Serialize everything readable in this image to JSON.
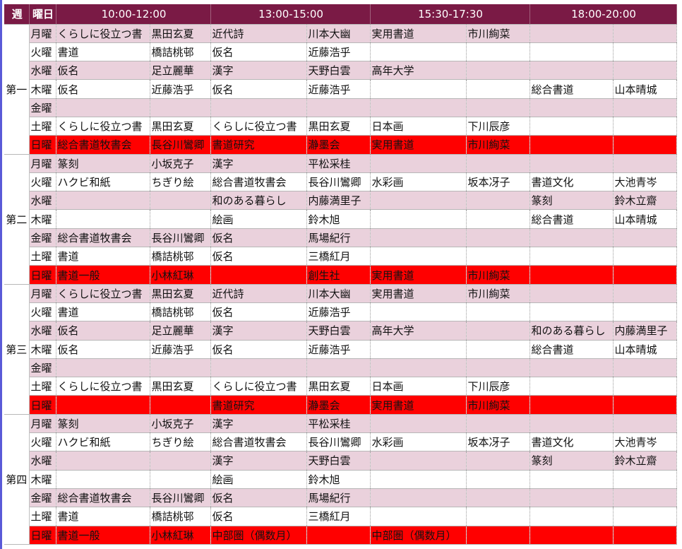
{
  "header": {
    "week": "週",
    "day": "曜日",
    "slots": [
      "10:00-12:00",
      "13:00-15:00",
      "15:30-17:30",
      "18:00-20:00"
    ]
  },
  "weeks": [
    {
      "label": "第一",
      "rows": [
        {
          "style": "pink",
          "day": "月曜",
          "cells": [
            "くらしに役立つ書",
            "黒田玄夏",
            "近代詩",
            "川本大幽",
            "実用書道",
            "市川絢菜",
            "",
            ""
          ]
        },
        {
          "style": "white",
          "day": "火曜",
          "cells": [
            "書道",
            "橋詰桃邨",
            "仮名",
            "近藤浩乎",
            "",
            "",
            "",
            ""
          ]
        },
        {
          "style": "pink",
          "day": "水曜",
          "cells": [
            "仮名",
            "足立麗華",
            "漢字",
            "天野白雲",
            "高年大学",
            "",
            "",
            ""
          ]
        },
        {
          "style": "white",
          "day": "木曜",
          "cells": [
            "仮名",
            "近藤浩乎",
            "仮名",
            "近藤浩乎",
            "",
            "",
            "総合書道",
            "山本晴城"
          ]
        },
        {
          "style": "pink",
          "day": "金曜",
          "cells": [
            "",
            "",
            "",
            "",
            "",
            "",
            "",
            ""
          ]
        },
        {
          "style": "white",
          "day": "土曜",
          "cells": [
            "くらしに役立つ書",
            "黒田玄夏",
            "くらしに役立つ書",
            "黒田玄夏",
            "日本画",
            "下川辰彦",
            "",
            ""
          ]
        },
        {
          "style": "red",
          "day": "日曜",
          "cells": [
            "総合書道牧書会",
            "長谷川鸞卿",
            "書道研究",
            "瀞墨会",
            "実用書道",
            "市川絢菜",
            "",
            ""
          ]
        }
      ]
    },
    {
      "label": "第二",
      "rows": [
        {
          "style": "pink",
          "day": "月曜",
          "cells": [
            "篆刻",
            "小坂克子",
            "漢字",
            "平松采桂",
            "",
            "",
            "",
            ""
          ]
        },
        {
          "style": "white",
          "day": "火曜",
          "cells": [
            "ハクビ和紙",
            "ちぎり絵",
            "総合書道牧書会",
            "長谷川鸞卿",
            "水彩画",
            "坂本冴子",
            "書道文化",
            "大池青岑"
          ]
        },
        {
          "style": "pink",
          "day": "水曜",
          "cells": [
            "",
            "",
            "和のある暮らし",
            "内藤満里子",
            "",
            "",
            "篆刻",
            "鈴木立齋"
          ]
        },
        {
          "style": "white",
          "day": "木曜",
          "cells": [
            "",
            "",
            "絵画",
            "鈴木旭",
            "",
            "",
            "総合書道",
            "山本晴城"
          ]
        },
        {
          "style": "pink",
          "day": "金曜",
          "cells": [
            "総合書道牧書会",
            "長谷川鸞卿",
            "仮名",
            "馬場紀行",
            "",
            "",
            "",
            ""
          ]
        },
        {
          "style": "white",
          "day": "土曜",
          "cells": [
            "書道",
            "橋詰桃邨",
            "仮名",
            "三橋紅月",
            "",
            "",
            "",
            ""
          ]
        },
        {
          "style": "red",
          "day": "日曜",
          "cells": [
            "書道一般",
            "小林紅琳",
            "",
            "創生社",
            "実用書道",
            "市川絢菜",
            "",
            ""
          ]
        }
      ]
    },
    {
      "label": "第三",
      "rows": [
        {
          "style": "pink",
          "day": "月曜",
          "cells": [
            "くらしに役立つ書",
            "黒田玄夏",
            "近代詩",
            "川本大幽",
            "実用書道",
            "市川絢菜",
            "",
            ""
          ]
        },
        {
          "style": "white",
          "day": "火曜",
          "cells": [
            "書道",
            "橋詰桃邨",
            "仮名",
            "近藤浩乎",
            "",
            "",
            "",
            ""
          ]
        },
        {
          "style": "pink",
          "day": "水曜",
          "cells": [
            "仮名",
            "足立麗華",
            "漢字",
            "天野白雲",
            "高年大学",
            "",
            "和のある暮らし",
            "内藤満里子"
          ]
        },
        {
          "style": "white",
          "day": "木曜",
          "cells": [
            "仮名",
            "近藤浩乎",
            "仮名",
            "近藤浩乎",
            "",
            "",
            "総合書道",
            "山本晴城"
          ]
        },
        {
          "style": "pink",
          "day": "金曜",
          "cells": [
            "",
            "",
            "",
            "",
            "",
            "",
            "",
            ""
          ]
        },
        {
          "style": "white",
          "day": "土曜",
          "cells": [
            "くらしに役立つ書",
            "黒田玄夏",
            "くらしに役立つ書",
            "黒田玄夏",
            "日本画",
            "下川辰彦",
            "",
            ""
          ]
        },
        {
          "style": "red",
          "day": "日曜",
          "cells": [
            "",
            "",
            "書道研究",
            "瀞墨会",
            "実用書道",
            "市川絢菜",
            "",
            ""
          ]
        }
      ]
    },
    {
      "label": "第四",
      "rows": [
        {
          "style": "pink",
          "day": "月曜",
          "cells": [
            "篆刻",
            "小坂克子",
            "漢字",
            "平松采桂",
            "",
            "",
            "",
            ""
          ]
        },
        {
          "style": "white",
          "day": "火曜",
          "cells": [
            "ハクビ和紙",
            "ちぎり絵",
            "総合書道牧書会",
            "長谷川鸞卿",
            "水彩画",
            "坂本冴子",
            "書道文化",
            "大池青岑"
          ]
        },
        {
          "style": "pink",
          "day": "水曜",
          "cells": [
            "",
            "",
            "漢字",
            "天野白雲",
            "",
            "",
            "篆刻",
            "鈴木立齋"
          ]
        },
        {
          "style": "white",
          "day": "木曜",
          "cells": [
            "",
            "",
            "絵画",
            "鈴木旭",
            "",
            "",
            "",
            ""
          ]
        },
        {
          "style": "pink",
          "day": "金曜",
          "cells": [
            "総合書道牧書会",
            "長谷川鸞卿",
            "仮名",
            "馬場紀行",
            "",
            "",
            "",
            ""
          ]
        },
        {
          "style": "white",
          "day": "土曜",
          "cells": [
            "書道",
            "橋詰桃邨",
            "仮名",
            "三橋紅月",
            "",
            "",
            "",
            ""
          ]
        },
        {
          "style": "red",
          "day": "日曜",
          "cells": [
            "書道一般",
            "小林紅琳",
            "中部圏（偶数月）",
            "",
            "中部圏（偶数月）",
            "",
            "",
            ""
          ]
        }
      ]
    }
  ],
  "colors": {
    "header": "#7a1a45",
    "pink_row": "#ead1dc",
    "sunday_row": "#ff0000",
    "left_border": "#5a5ad8"
  }
}
